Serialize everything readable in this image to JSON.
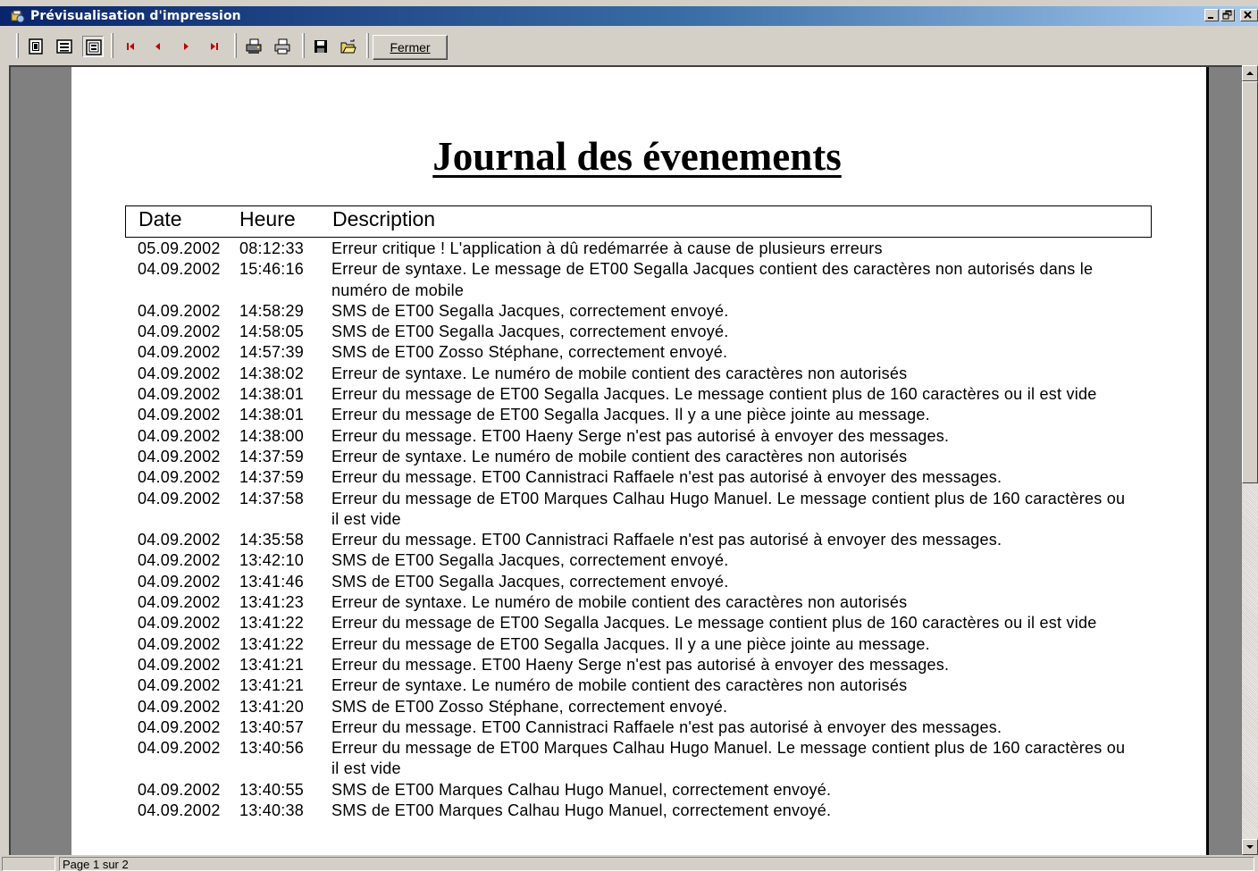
{
  "window": {
    "title": "Prévisualisation d'impression"
  },
  "toolbar": {
    "buttons": [
      {
        "icon": "one-page-icon"
      },
      {
        "icon": "full-width-icon"
      },
      {
        "icon": "fit-page-icon"
      },
      {
        "icon": "first-page-icon"
      },
      {
        "icon": "previous-page-icon"
      },
      {
        "icon": "next-page-icon"
      },
      {
        "icon": "last-page-icon"
      },
      {
        "icon": "print-setup-icon"
      },
      {
        "icon": "printer-icon"
      },
      {
        "icon": "save-icon"
      },
      {
        "icon": "open-folder-icon"
      }
    ],
    "close_label": "Fermer"
  },
  "report": {
    "title": "Journal des évenements",
    "columns": {
      "date": "Date",
      "time": "Heure",
      "description": "Description"
    },
    "rows": [
      {
        "date": "05.09.2002",
        "time": "08:12:33",
        "desc": "Erreur critique ! L'application à dû redémarrée à cause de plusieurs erreurs"
      },
      {
        "date": "04.09.2002",
        "time": "15:46:16",
        "desc": "Erreur de syntaxe. Le message de ET00 Segalla Jacques contient des caractères non autorisés dans le numéro de mobile"
      },
      {
        "date": "04.09.2002",
        "time": "14:58:29",
        "desc": "SMS de ET00 Segalla Jacques, correctement envoyé."
      },
      {
        "date": "04.09.2002",
        "time": "14:58:05",
        "desc": "SMS de ET00 Segalla Jacques, correctement envoyé."
      },
      {
        "date": "04.09.2002",
        "time": "14:57:39",
        "desc": "SMS de ET00 Zosso Stéphane, correctement envoyé."
      },
      {
        "date": "04.09.2002",
        "time": "14:38:02",
        "desc": "Erreur de syntaxe. Le numéro de mobile contient des caractères non autorisés"
      },
      {
        "date": "04.09.2002",
        "time": "14:38:01",
        "desc": "Erreur du message de ET00 Segalla Jacques. Le message contient plus de 160 caractères ou il est vide"
      },
      {
        "date": "04.09.2002",
        "time": "14:38:01",
        "desc": "Erreur du message de ET00 Segalla Jacques. Il y a une pièce jointe au message."
      },
      {
        "date": "04.09.2002",
        "time": "14:38:00",
        "desc": "Erreur du message. ET00 Haeny Serge n'est pas autorisé à envoyer des messages."
      },
      {
        "date": "04.09.2002",
        "time": "14:37:59",
        "desc": "Erreur de syntaxe. Le numéro de mobile contient des caractères non autorisés"
      },
      {
        "date": "04.09.2002",
        "time": "14:37:59",
        "desc": "Erreur du message. ET00 Cannistraci Raffaele n'est pas autorisé à envoyer des messages."
      },
      {
        "date": "04.09.2002",
        "time": "14:37:58",
        "desc": "Erreur du message de ET00 Marques Calhau Hugo Manuel. Le message contient plus de 160 caractères ou il est vide"
      },
      {
        "date": "04.09.2002",
        "time": "14:35:58",
        "desc": "Erreur du message. ET00 Cannistraci Raffaele n'est pas autorisé à envoyer des messages."
      },
      {
        "date": "04.09.2002",
        "time": "13:42:10",
        "desc": "SMS de ET00 Segalla Jacques, correctement envoyé."
      },
      {
        "date": "04.09.2002",
        "time": "13:41:46",
        "desc": "SMS de ET00 Segalla Jacques, correctement envoyé."
      },
      {
        "date": "04.09.2002",
        "time": "13:41:23",
        "desc": "Erreur de syntaxe. Le numéro de mobile contient des caractères non autorisés"
      },
      {
        "date": "04.09.2002",
        "time": "13:41:22",
        "desc": "Erreur du message de ET00 Segalla Jacques. Le message contient plus de 160 caractères ou il est vide"
      },
      {
        "date": "04.09.2002",
        "time": "13:41:22",
        "desc": "Erreur du message de ET00 Segalla Jacques. Il y a une pièce jointe au message."
      },
      {
        "date": "04.09.2002",
        "time": "13:41:21",
        "desc": "Erreur du message. ET00 Haeny Serge n'est pas autorisé à envoyer des messages."
      },
      {
        "date": "04.09.2002",
        "time": "13:41:21",
        "desc": "Erreur de syntaxe. Le numéro de mobile contient des caractères non autorisés"
      },
      {
        "date": "04.09.2002",
        "time": "13:41:20",
        "desc": "SMS de ET00 Zosso Stéphane, correctement envoyé."
      },
      {
        "date": "04.09.2002",
        "time": "13:40:57",
        "desc": "Erreur du message. ET00 Cannistraci Raffaele n'est pas autorisé à envoyer des messages."
      },
      {
        "date": "04.09.2002",
        "time": "13:40:56",
        "desc": "Erreur du message de ET00 Marques Calhau Hugo Manuel. Le message contient plus de 160 caractères ou il est vide"
      },
      {
        "date": "04.09.2002",
        "time": "13:40:55",
        "desc": "SMS de ET00 Marques Calhau Hugo Manuel, correctement envoyé."
      },
      {
        "date": "04.09.2002",
        "time": "13:40:38",
        "desc": "SMS de ET00 Marques Calhau Hugo Manuel, correctement envoyé."
      }
    ]
  },
  "status": {
    "page_info": "Page 1 sur 2"
  },
  "colors": {
    "titlebar_start": "#0a246a",
    "titlebar_end": "#a6caf0",
    "nav_arrow": "#c00000",
    "chrome": "#d4d0c8"
  }
}
